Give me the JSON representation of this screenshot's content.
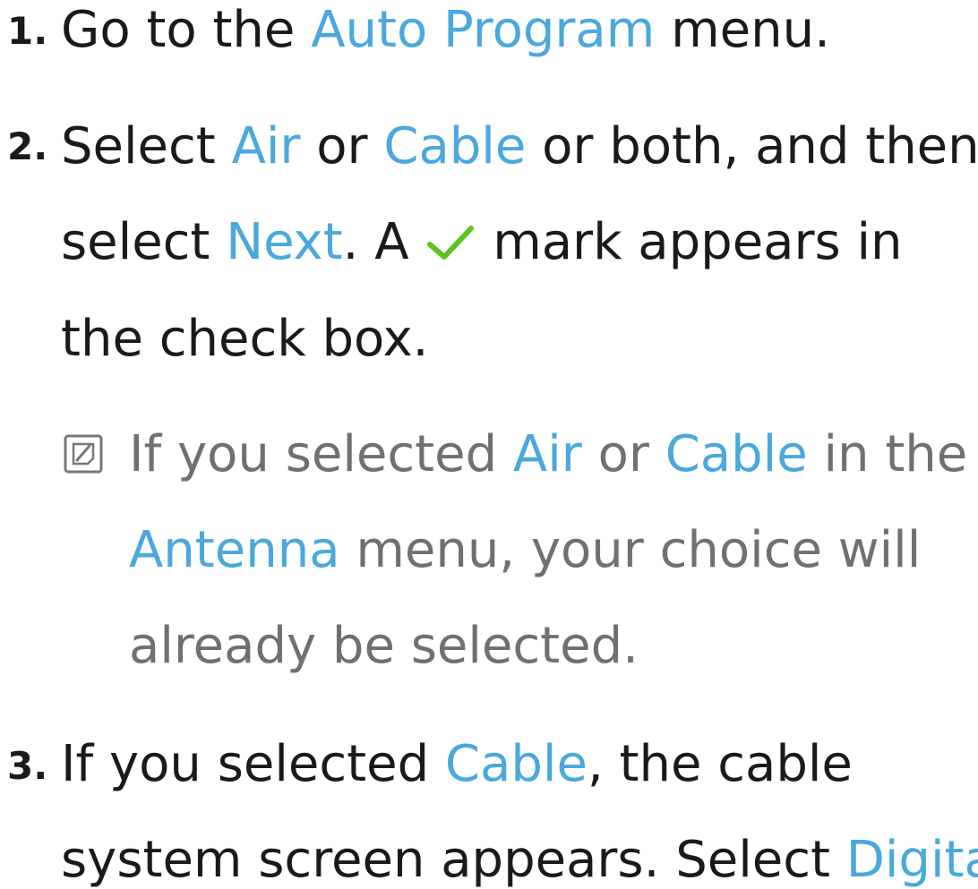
{
  "steps": [
    {
      "number": "1.",
      "lines": [
        [
          "Go to the ",
          "Auto Program",
          " menu."
        ]
      ]
    },
    {
      "number": "2.",
      "lines": [
        [
          "Select ",
          "Air",
          " or ",
          "Cable",
          " or both, and then"
        ],
        [
          "select ",
          "Next",
          ". A ",
          "mark appears in"
        ],
        [
          "the check box."
        ]
      ]
    },
    {
      "number": "3.",
      "lines": [
        [
          "If you selected ",
          "Cable",
          ", the cable"
        ],
        [
          "system screen appears. Select ",
          "Digital"
        ]
      ]
    }
  ],
  "note": {
    "icon": "note-icon",
    "lines": [
      [
        "If you selected ",
        "Air",
        " or ",
        "Cable",
        " in the"
      ],
      [
        "Antenna",
        " menu, your choice will"
      ],
      [
        "already be selected."
      ]
    ]
  },
  "colors": {
    "highlight": "#4aa8dc",
    "body_text": "#1a1a1a",
    "note_text": "#707070",
    "checkmark": "#5cc31f"
  },
  "icons": {
    "checkmark": "checkmark-icon"
  }
}
